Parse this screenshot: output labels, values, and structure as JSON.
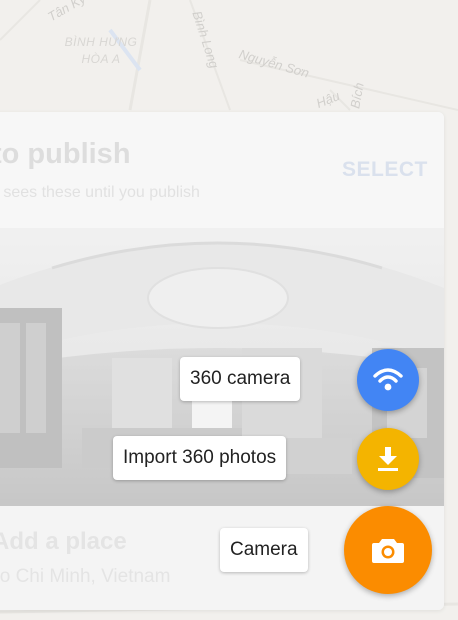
{
  "map": {
    "labels": [
      "Tân Kỳ",
      "BÌNH HƯNG HÒA A",
      "Bình Long",
      "Nguyễn Sơn",
      "Hậu",
      "Bích"
    ]
  },
  "card": {
    "title": "to publish",
    "subtitle": "e sees these until you publish",
    "select_label": "SELECT",
    "place_title": "Add a place",
    "place_subtitle": "Ho Chi Minh, Vietnam"
  },
  "fab_menu": {
    "camera360_label": "360 camera",
    "import360_label": "Import 360 photos",
    "camera_label": "Camera",
    "colors": {
      "camera360": "#4285f4",
      "import360": "#f4b400",
      "camera": "#fb8c00"
    },
    "icons": {
      "camera360": "wifi-icon",
      "import360": "download-icon",
      "camera": "camera-icon"
    }
  }
}
